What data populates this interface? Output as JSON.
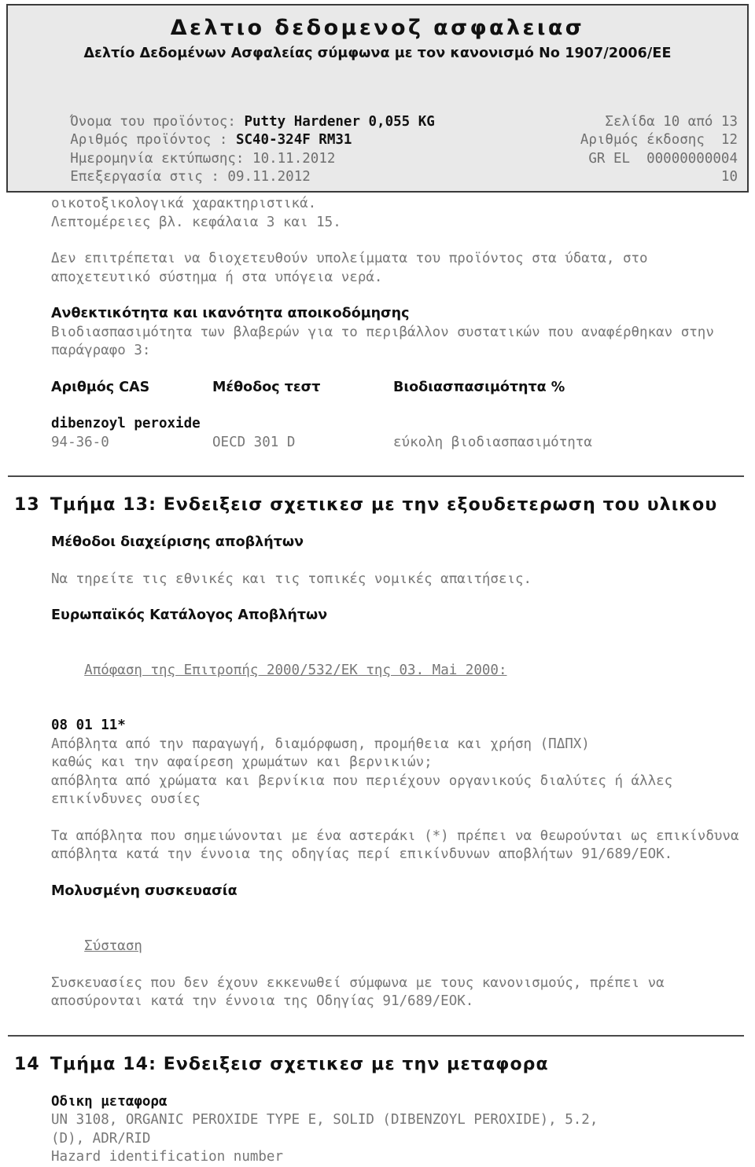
{
  "header": {
    "title": "Δελτιο δεδομενοζ ασφαλειασ",
    "subtitle": "Δελτίο Δεδομένων Ασφαλείας σύμφωνα με τον κανονισμό Νο 1907/2006/ΕΕ",
    "rows": [
      {
        "label": "Όνομα του προϊόντος",
        "sep": ": ",
        "value": "Putty Hardener 0,055 KG",
        "bold": true,
        "right": ""
      },
      {
        "label": "Αριθμός προϊόντος",
        "sep": " : ",
        "value": "SC40-324F RM31",
        "bold": true,
        "right": "Σελίδα 10 από 13"
      },
      {
        "label": "Ημερομηνία εκτύπωσης:",
        "sep": " ",
        "value": "10.11.2012",
        "bold": false,
        "right": "Αριθμός έκδοσης  12"
      },
      {
        "label": "Επεξεργασία στις",
        "sep": " : ",
        "value": "09.11.2012",
        "bold": false,
        "right": "GR EL  00000000004"
      }
    ],
    "tail": "10"
  },
  "body": {
    "ecotox_line1": "οικοτοξικολογικά χαρακτηριστικά.",
    "ecotox_line2": "Λεπτομέρειες βλ. κεφάλαια 3 και 15.",
    "discharge_para": "Δεν επιτρέπεται να διοχετευθούν υπολείμματα του προϊόντος στα ύδατα, στο αποχετευτικό σύστημα ή στα υπόγεια νερά.",
    "persistence_heading": "Ανθεκτικότητα και ικανότητα αποικοδόμησης",
    "persistence_intro": "Βιοδιασπασιμότητα των βλαβερών για το περιβάλλον συστατικών που αναφέρθηκαν στην παράγραφο 3:",
    "table": {
      "headers": [
        "Αριθμός CAS",
        "Μέθοδος τεστ",
        "Βιοδιασπασιμότητα %"
      ],
      "substance": "dibenzoyl peroxide",
      "row": [
        "94-36-0",
        "OECD 301 D",
        "εύκολη βιοδιασπασιμότητα"
      ]
    }
  },
  "section13": {
    "number": "13",
    "title": "Τμήμα 13: Ενδειξεισ σχετικεσ με την εξουδετερωση του υλικου",
    "waste_methods_heading": "Μέθοδοι διαχείρισης αποβλήτων",
    "waste_methods_text": "Να τηρείτε τις εθνικές και τις τοπικές νομικές απαιτήσεις.",
    "eu_catalog_heading": "Ευρωπαϊκός Κατάλογος Αποβλήτων",
    "decision_link": "Απόφαση της Επιτροπής 2000/532/ΕΚ της 03. Mai 2000:",
    "waste_code": "08 01 11*",
    "waste_desc_line1": "Απόβλητα από την παραγωγή, διαμόρφωση, προμήθεια και χρήση (ΠΔΠΧ)",
    "waste_desc_line2": "καθώς και την αφαίρεση χρωμάτων και βερνικιών;",
    "waste_desc_line3": "απόβλητα από χρώματα και βερνίκια που περιέχουν οργανικούς διαλύτες ή άλλες επικίνδυνες ουσίες",
    "asterisk_note": "Τα απόβλητα που σημειώνονται με ένα αστεράκι (*) πρέπει να θεωρούνται ως επικίνδυνα απόβλητα κατά την έννοια της οδηγίας περί επικίνδυνων αποβλήτων 91/689/ΕΟΚ.",
    "contaminated_heading": "Μολυσμένη συσκευασία",
    "recommendation_link": "Σύσταση",
    "recommendation_text": "Συσκευασίες που δεν έχουν εκκενωθεί σύμφωνα με τους κανονισμούς, πρέπει να αποσύρονται κατά την έννοια της Οδηγίας 91/689/ΕΟΚ."
  },
  "section14": {
    "number": "14",
    "title": "Τμήμα 14: Ενδειξεισ σχετικεσ με την μεταφορα",
    "road_heading": "Οδικη μεταφορα",
    "un_line1": "UN 3108, ORGANIC PEROXIDE TYPE E, SOLID (DIBENZOYL PEROXIDE), 5.2,",
    "un_line2": "(D), ADR/RID",
    "hazard_id_label": "Hazard identification number"
  },
  "colors": {
    "body_text": "#777777",
    "heading_text": "#111111",
    "header_bg": "#e9e9e9",
    "header_border": "#3a3a3a",
    "rule": "#4a4a4a"
  }
}
